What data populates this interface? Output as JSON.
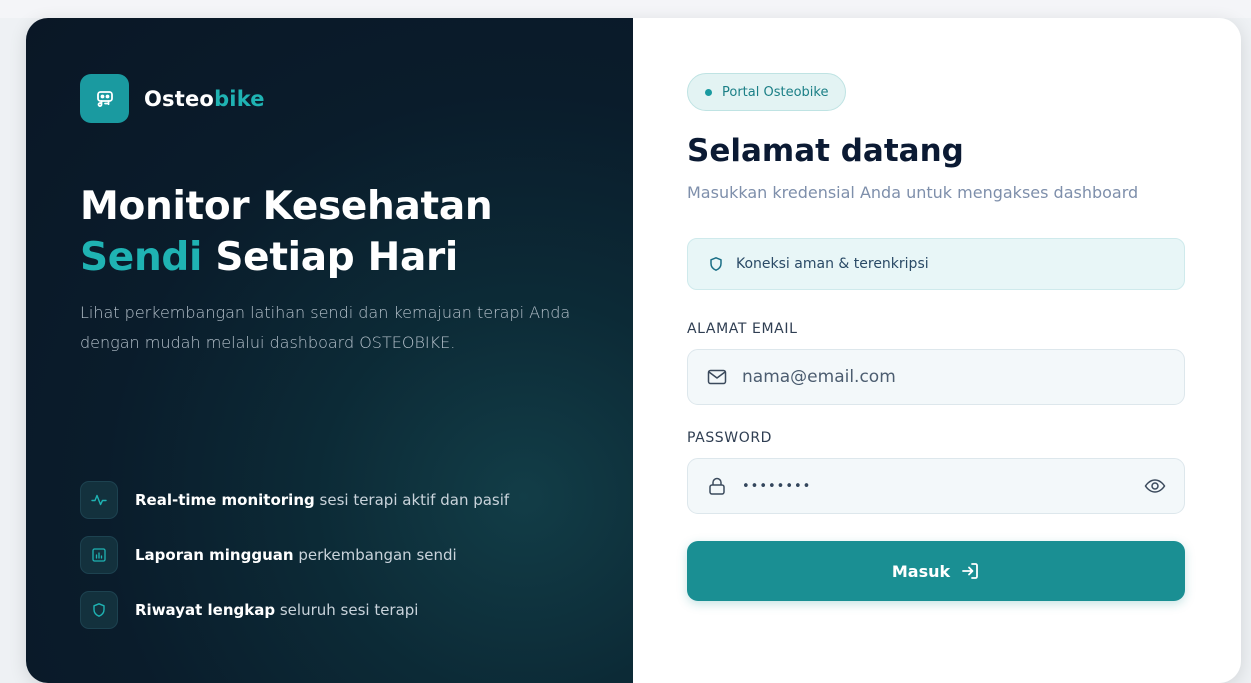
{
  "brand": {
    "name_part1": "Osteo",
    "name_part2": "bike",
    "logo_icon": "bike-icon"
  },
  "hero": {
    "line1": "Monitor Kesehatan",
    "line2_accent": "Sendi",
    "line2_rest": "Setiap Hari",
    "description": "Lihat perkembangan latihan sendi dan kemajuan terapi Anda dengan mudah melalui dashboard OSTEOBIKE."
  },
  "features": [
    {
      "icon": "activity-icon",
      "bold": "Real-time monitoring",
      "rest": "sesi terapi aktif dan pasif"
    },
    {
      "icon": "report-chart-icon",
      "bold": "Laporan mingguan",
      "rest": "perkembangan sendi"
    },
    {
      "icon": "shield-icon",
      "bold": "Riwayat lengkap",
      "rest": "seluruh sesi terapi"
    }
  ],
  "login": {
    "badge": "Portal Osteobike",
    "title": "Selamat datang",
    "subtitle": "Masukkan kredensial Anda untuk mengakses dashboard",
    "secure_notice": "Koneksi aman & terenkripsi",
    "email_label": "ALAMAT EMAIL",
    "email_placeholder": "nama@email.com",
    "password_label": "PASSWORD",
    "password_value": "••••••••",
    "submit_label": "Masuk"
  },
  "colors": {
    "accent": "#1a9aa0",
    "dark_panel": "#0a1c2b",
    "button": "#1a8f93"
  }
}
